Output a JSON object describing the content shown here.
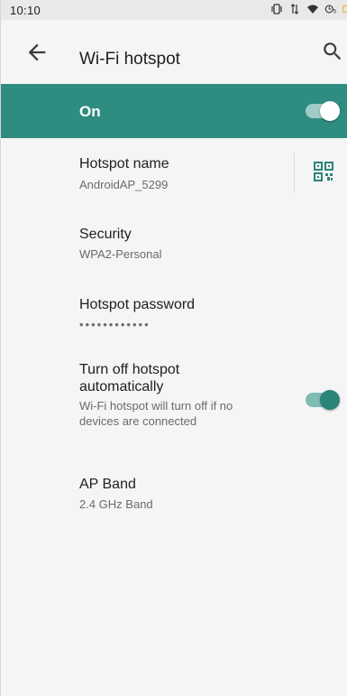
{
  "status_bar": {
    "time": "10:10",
    "icons": [
      "vibrate-icon",
      "data-arrows-icon",
      "wifi-hotspot-icon",
      "signal-icon",
      "battery-icon"
    ]
  },
  "app_bar": {
    "title": "Wi-Fi hotspot",
    "back_icon": "arrow-back-icon",
    "search_icon": "search-icon"
  },
  "master_switch": {
    "label": "On",
    "checked": true
  },
  "settings": [
    {
      "key": "hotspot_name",
      "title": "Hotspot name",
      "summary": "AndroidAP_5299",
      "trailing_icon": "qr-code-icon"
    },
    {
      "key": "security",
      "title": "Security",
      "summary": "WPA2-Personal"
    },
    {
      "key": "password",
      "title": "Hotspot password",
      "summary": "••••••••••••"
    },
    {
      "key": "auto_off",
      "title_line1": "Turn off hotspot",
      "title_line2": "automatically",
      "summary_line1": "Wi-Fi hotspot will turn off if no",
      "summary_line2": "devices are connected",
      "checked": true
    },
    {
      "key": "ap_band",
      "title": "AP Band",
      "summary": "2.4 GHz Band"
    }
  ],
  "colors": {
    "accent": "#2f8c80",
    "toggle_on": "#2a8477",
    "background": "#f5f5f5"
  }
}
